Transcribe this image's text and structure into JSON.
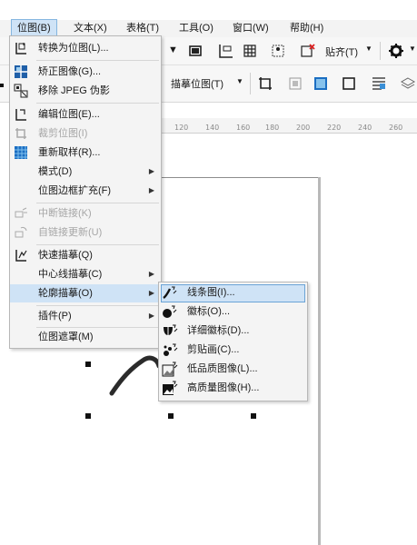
{
  "menubar": {
    "items": [
      {
        "label": "位图(B)"
      },
      {
        "label": "文本(X)"
      },
      {
        "label": "表格(T)"
      },
      {
        "label": "工具(O)"
      },
      {
        "label": "窗口(W)"
      },
      {
        "label": "帮助(H)"
      }
    ]
  },
  "toolbar": {
    "align_label": "贴齐(T)",
    "trace_label": "描摹位图(T)"
  },
  "ruler": {
    "ticks": [
      "120",
      "140",
      "160",
      "180",
      "200",
      "220",
      "240",
      "260"
    ]
  },
  "bitmap_menu": {
    "items": [
      {
        "label": "转换为位图(L)...",
        "icon": "convert-bitmap-icon",
        "enabled": true
      },
      {
        "label": "矫正图像(G)...",
        "icon": "straighten-image-icon",
        "enabled": true
      },
      {
        "label": "移除 JPEG 伪影",
        "icon": "remove-jpeg-artifacts-icon",
        "enabled": true
      },
      {
        "label": "编辑位图(E)...",
        "icon": "edit-bitmap-icon",
        "enabled": true
      },
      {
        "label": "裁剪位图(I)",
        "icon": "crop-bitmap-icon",
        "enabled": false
      },
      {
        "label": "重新取样(R)...",
        "icon": "resample-icon",
        "enabled": true
      },
      {
        "label": "模式(D)",
        "icon": "",
        "enabled": true,
        "submenu": true
      },
      {
        "label": "位图边框扩充(F)",
        "icon": "",
        "enabled": true,
        "submenu": true
      },
      {
        "label": "中断链接(K)",
        "icon": "break-link-icon",
        "enabled": false
      },
      {
        "label": "自链接更新(U)",
        "icon": "update-link-icon",
        "enabled": false
      },
      {
        "label": "快速描摹(Q)",
        "icon": "quick-trace-icon",
        "enabled": true
      },
      {
        "label": "中心线描摹(C)",
        "icon": "",
        "enabled": true,
        "submenu": true
      },
      {
        "label": "轮廓描摹(O)",
        "icon": "",
        "enabled": true,
        "submenu": true,
        "highlighted": true
      },
      {
        "label": "插件(P)",
        "icon": "",
        "enabled": true,
        "submenu": true
      },
      {
        "label": "位图遮罩(M)",
        "icon": "",
        "enabled": true
      }
    ]
  },
  "outline_trace_submenu": {
    "items": [
      {
        "label": "线条图(I)...",
        "icon": "line-art-icon",
        "highlighted": true
      },
      {
        "label": "徽标(O)...",
        "icon": "logo-icon"
      },
      {
        "label": "详细徽标(D)...",
        "icon": "detailed-logo-icon"
      },
      {
        "label": "剪贴画(C)...",
        "icon": "clipart-icon"
      },
      {
        "label": "低品质图像(L)...",
        "icon": "low-quality-image-icon"
      },
      {
        "label": "高质量图像(H)...",
        "icon": "high-quality-image-icon"
      }
    ]
  }
}
